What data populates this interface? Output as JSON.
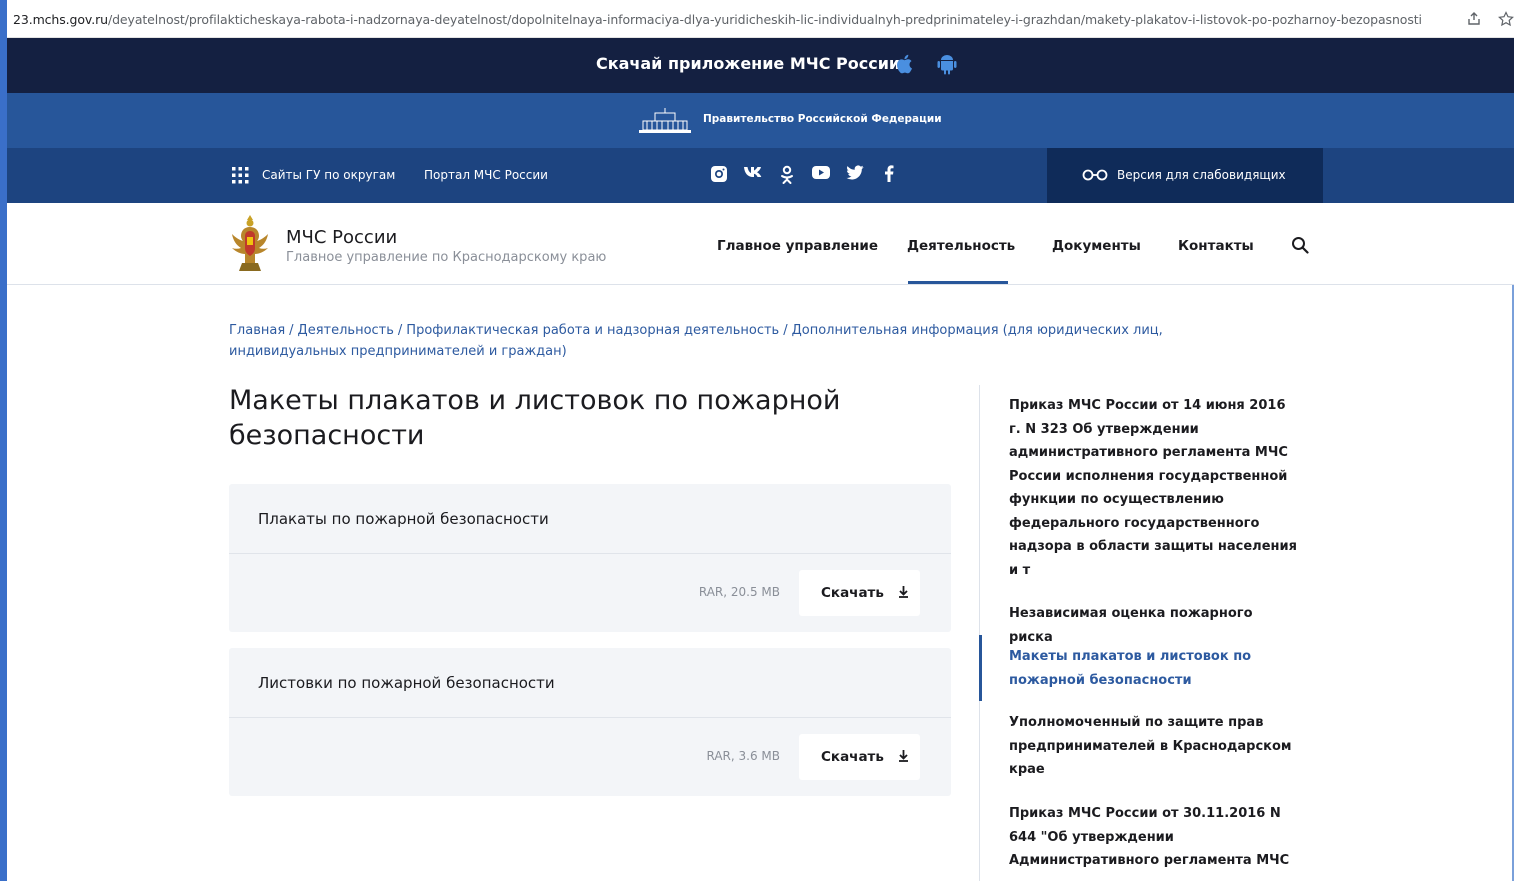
{
  "browser": {
    "url_host": "23.mchs.gov.ru",
    "url_path": "/deyatelnost/profilakticheskaya-rabota-i-nadzornaya-deyatelnost/dopolnitelnaya-informaciya-dlya-yuridicheskih-lic-individualnyh-predprinimateley-i-grazhdan/makety-plakatov-i-listovok-po-pozharnoy-bezopasnosti"
  },
  "app_bar": {
    "label": "Скачай приложение МЧС России"
  },
  "gov_bar": {
    "label": "Правительство Российской Федерации"
  },
  "links_bar": {
    "sites_prefix": "Сайты ГУ",
    "sites_suffix": " по округам",
    "portal": "Портал МЧС России",
    "vision": "Версия для слабовидящих"
  },
  "header": {
    "org_name": "МЧС России",
    "org_sub": "Главное управление по Краснодарскому краю",
    "nav": {
      "main": "Главное управление",
      "activity": "Деятельность",
      "docs": "Документы",
      "contacts": "Контакты"
    }
  },
  "breadcrumb": {
    "items": [
      "Главная",
      "Деятельность",
      "Профилактическая работа и надзорная деятельность",
      "Дополнительная информация (для юридических лиц, индивидуальных предпринимателей и граждан)"
    ],
    "separator": "/"
  },
  "page": {
    "title": "Макеты плакатов и листовок по пожарной безопасности"
  },
  "files": [
    {
      "title": "Плакаты по пожарной безопасности",
      "size": "RAR, 20.5 MB",
      "button": "Скачать"
    },
    {
      "title": "Листовки по пожарной безопасности",
      "size": "RAR, 3.6 MB",
      "button": "Скачать"
    }
  ],
  "sidebar": {
    "items": [
      "Приказ МЧС России от 14 июня 2016 г. N 323 Об утверждении административного регламента МЧС России исполнения государственной функции по осуществлению федерального государственного надзора в области защиты населения и т",
      "Независимая оценка пожарного риска",
      "Макеты плакатов и листовок по пожарной безопасности",
      "Уполномоченный по защите прав предпринимателей в Краснодарском крае",
      "Приказ МЧС России от 30.11.2016 N 644 \"Об утверждении Административного регламента МЧС"
    ]
  },
  "colors": {
    "app_bar_bg": "#142041",
    "gov_bar_bg": "#27569a",
    "links_bar_bg": "#1d4480",
    "accent": "#27569a",
    "link": "#2d5aa0"
  }
}
